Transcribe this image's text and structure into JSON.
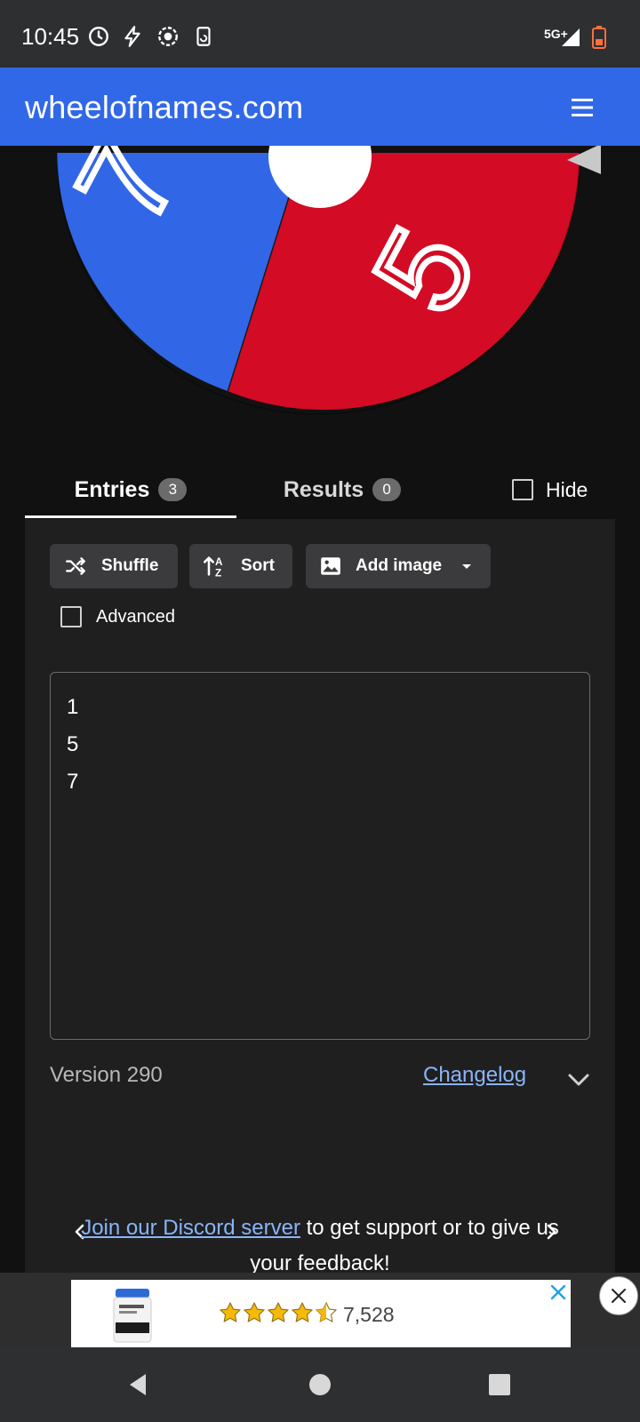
{
  "status_bar": {
    "time": "10:45",
    "network": "5G+",
    "icons": [
      "alarm-icon",
      "flash-icon",
      "record-icon",
      "screen-rotate-icon",
      "signal-icon",
      "battery-icon"
    ]
  },
  "app_bar": {
    "title": "wheelofnames.com",
    "menu_icon": "hamburger-menu-icon",
    "color": "#3168e7"
  },
  "wheel": {
    "segments": [
      {
        "label": "7",
        "color": "#3167e6"
      },
      {
        "label": "5",
        "color": "#d30b24"
      }
    ],
    "pointer_icon": "wheel-pointer-icon"
  },
  "tabs": {
    "entries_label": "Entries",
    "entries_count": "3",
    "results_label": "Results",
    "results_count": "0",
    "hide_label": "Hide"
  },
  "toolbar": {
    "shuffle_label": "Shuffle",
    "sort_label": "Sort",
    "add_image_label": "Add image",
    "advanced_label": "Advanced"
  },
  "entries": [
    "1",
    "5",
    "7"
  ],
  "footer": {
    "version": "Version 290",
    "changelog": "Changelog"
  },
  "promo": {
    "link_text": "Join our Discord server",
    "rest_text": " to get support or to give us your feedback!"
  },
  "ad": {
    "rating_count": "7,528",
    "stars": 4.5
  }
}
